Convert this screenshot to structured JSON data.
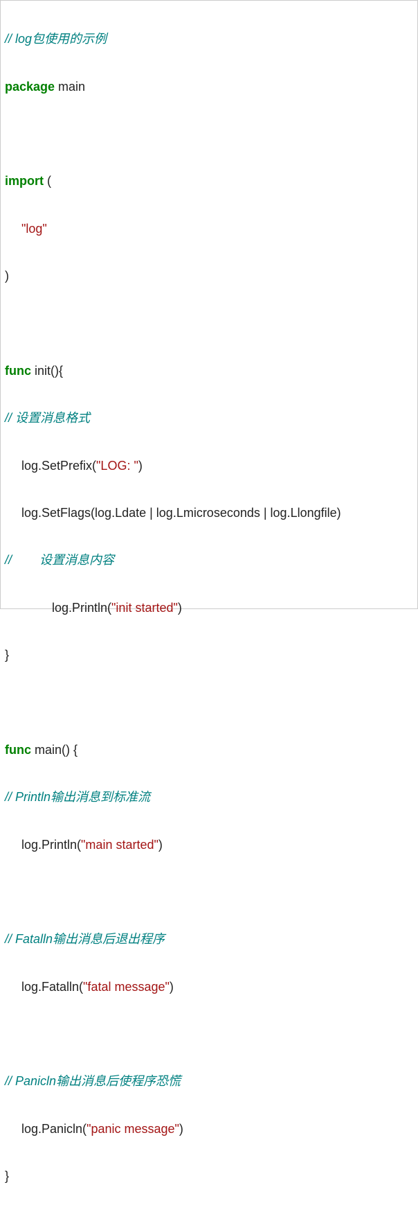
{
  "code": {
    "line1_comment": "// log包使用的示例",
    "line2_kw": "package",
    "line2_rest": " main",
    "line4_kw": "import",
    "line4_rest": " (",
    "line5_str": "\"log\"",
    "line6": ")",
    "line8_kw": "func",
    "line8_rest": " init(){",
    "line9_comment": "// 设置消息格式",
    "line10_a": "log.SetPrefix(",
    "line10_str": "\"LOG: \"",
    "line10_b": ")",
    "line11": "log.SetFlags(log.Ldate | log.Lmicroseconds | log.Llongfile)",
    "line12_comment": "//        设置消息内容",
    "line13_a": "log.Println(",
    "line13_str": "\"init started\"",
    "line13_b": ")",
    "line14": "}",
    "line16_kw": "func",
    "line16_rest": " main() {",
    "line17_comment": "// Println输出消息到标准流",
    "line18_a": "log.Println(",
    "line18_str": "\"main started\"",
    "line18_b": ")",
    "line20_comment": "// Fatalln输出消息后退出程序",
    "line21_a": "log.Fatalln(",
    "line21_str": "\"fatal message\"",
    "line21_b": ")",
    "line23_comment": "// Panicln输出消息后使程序恐慌",
    "line24_a": "log.Panicln(",
    "line24_str": "\"panic message\"",
    "line24_b": ")",
    "line25": "}"
  }
}
